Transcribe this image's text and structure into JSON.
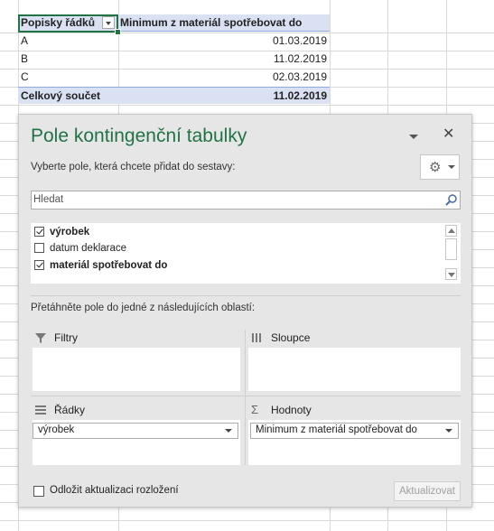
{
  "pivot_table": {
    "header": {
      "row_labels": "Popisky řádků",
      "value_column": "Minimum z materiál spotřebovat do"
    },
    "rows": [
      {
        "label": "A",
        "value": "01.03.2019"
      },
      {
        "label": "B",
        "value": "11.02.2019"
      },
      {
        "label": "C",
        "value": "02.03.2019"
      }
    ],
    "total": {
      "label": "Celkový součet",
      "value": "11.02.2019"
    }
  },
  "field_pane": {
    "title": "Pole kontingenční tabulky",
    "instruction": "Vyberte pole, která chcete přidat do sestavy:",
    "search_placeholder": "Hledat",
    "fields": [
      {
        "label": "výrobek",
        "checked": true
      },
      {
        "label": "datum deklarace",
        "checked": false
      },
      {
        "label": "materiál spotřebovat do",
        "checked": true
      }
    ],
    "areas_instruction": "Přetáhněte pole do jedné z následujících oblastí:",
    "areas": {
      "filters": {
        "label": "Filtry",
        "icon": "filter-icon"
      },
      "columns": {
        "label": "Sloupce",
        "icon": "columns-icon"
      },
      "rows": {
        "label": "Řádky",
        "icon": "rows-icon",
        "items": [
          "výrobek"
        ]
      },
      "values": {
        "label": "Hodnoty",
        "icon": "sigma-icon",
        "items": [
          "Minimum z materiál spotřebovat do"
        ]
      }
    },
    "defer_label": "Odložit aktualizaci rozložení",
    "update_button": "Aktualizovat",
    "close_glyph": "✕",
    "gear_glyph": "⚙"
  },
  "colors": {
    "accent_green": "#217346",
    "pivot_header_fill": "#d9e1f2",
    "grid_line": "#d9d9d9"
  }
}
